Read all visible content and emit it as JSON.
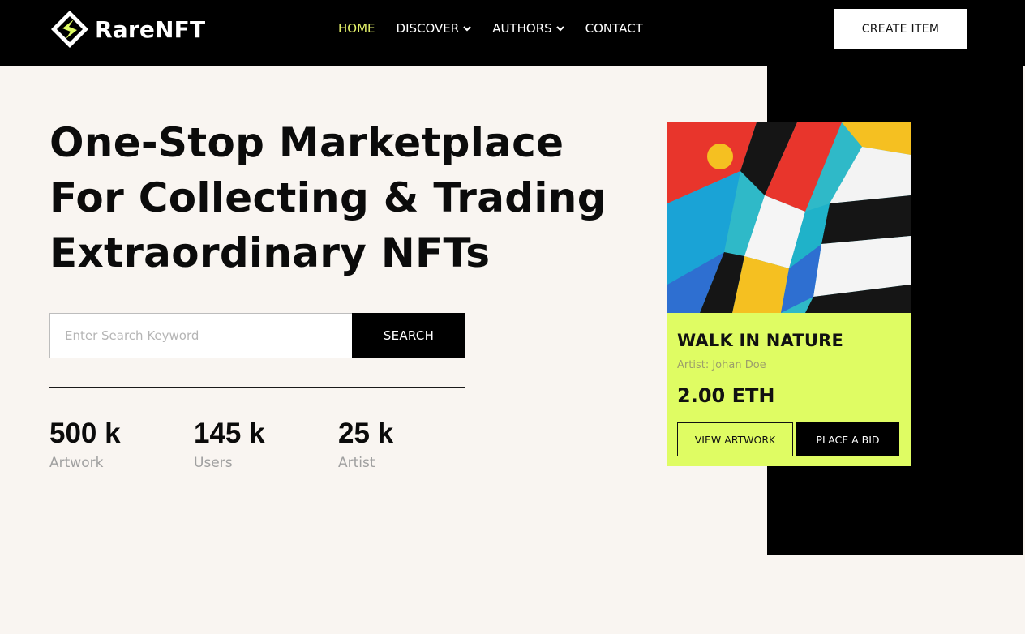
{
  "brand": {
    "name": "RareNFT",
    "logo_icon": "diamond-s-logo-icon",
    "accent_color": "#dffc63"
  },
  "nav": {
    "items": [
      {
        "label": "HOME",
        "active": true,
        "dropdown": false
      },
      {
        "label": "DISCOVER",
        "active": false,
        "dropdown": true
      },
      {
        "label": "AUTHORS",
        "active": false,
        "dropdown": true
      },
      {
        "label": "CONTACT",
        "active": false,
        "dropdown": false
      }
    ],
    "active_color": "#e4f26a",
    "create_label": "CREATE ITEM"
  },
  "hero": {
    "title_lines": [
      "One-Stop Marketplace",
      "For Collecting & Trading",
      "Extraordinary NFTs"
    ]
  },
  "search": {
    "placeholder": "Enter Search Keyword",
    "value": "",
    "button_label": "SEARCH"
  },
  "stats": [
    {
      "value": "500 k",
      "label": "Artwork"
    },
    {
      "value": "145 k",
      "label": "Users"
    },
    {
      "value": "25 k",
      "label": "Artist"
    }
  ],
  "card": {
    "title": "WALK IN NATURE",
    "artist": "Artist: Johan Doe",
    "price": "2.00 ETH",
    "view_label": "VIEW ARTWORK",
    "bid_label": "PLACE A BID",
    "image_icon": "abstract-artwork-image"
  }
}
